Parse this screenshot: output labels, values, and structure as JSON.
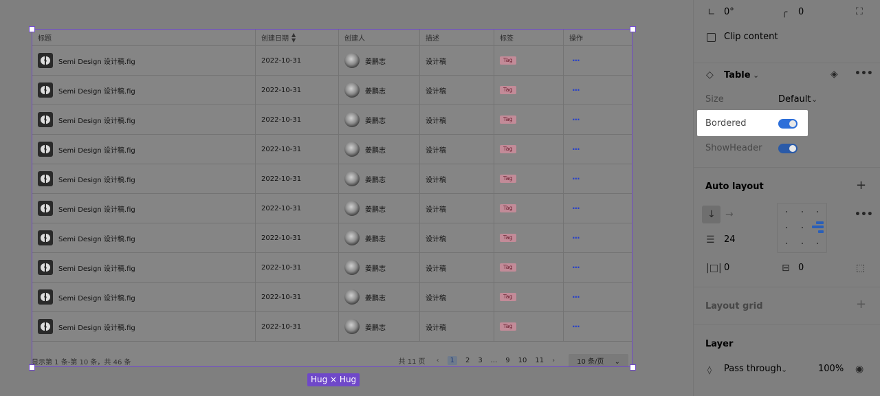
{
  "table": {
    "headers": [
      "标题",
      "创建日期",
      "创建人",
      "描述",
      "标签",
      "操作"
    ],
    "rows": [
      {
        "title": "Semi Design 设计稿.fig",
        "date": "2022-10-31",
        "creator": "姜鹏志",
        "desc": "设计稿",
        "tag": "Tag",
        "action": "···"
      },
      {
        "title": "Semi Design 设计稿.fig",
        "date": "2022-10-31",
        "creator": "姜鹏志",
        "desc": "设计稿",
        "tag": "Tag",
        "action": "···"
      },
      {
        "title": "Semi Design 设计稿.fig",
        "date": "2022-10-31",
        "creator": "姜鹏志",
        "desc": "设计稿",
        "tag": "Tag",
        "action": "···"
      },
      {
        "title": "Semi Design 设计稿.fig",
        "date": "2022-10-31",
        "creator": "姜鹏志",
        "desc": "设计稿",
        "tag": "Tag",
        "action": "···"
      },
      {
        "title": "Semi Design 设计稿.fig",
        "date": "2022-10-31",
        "creator": "姜鹏志",
        "desc": "设计稿",
        "tag": "Tag",
        "action": "···"
      },
      {
        "title": "Semi Design 设计稿.fig",
        "date": "2022-10-31",
        "creator": "姜鹏志",
        "desc": "设计稿",
        "tag": "Tag",
        "action": "···"
      },
      {
        "title": "Semi Design 设计稿.fig",
        "date": "2022-10-31",
        "creator": "姜鹏志",
        "desc": "设计稿",
        "tag": "Tag",
        "action": "···"
      },
      {
        "title": "Semi Design 设计稿.fig",
        "date": "2022-10-31",
        "creator": "姜鹏志",
        "desc": "设计稿",
        "tag": "Tag",
        "action": "···"
      },
      {
        "title": "Semi Design 设计稿.fig",
        "date": "2022-10-31",
        "creator": "姜鹏志",
        "desc": "设计稿",
        "tag": "Tag",
        "action": "···"
      },
      {
        "title": "Semi Design 设计稿.fig",
        "date": "2022-10-31",
        "creator": "姜鹏志",
        "desc": "设计稿",
        "tag": "Tag",
        "action": "···"
      }
    ],
    "footer_summary": "显示第 1 条-第 10 条，共 46 条",
    "pagination": {
      "total_pages": "共 11 页",
      "pages": [
        "1",
        "2",
        "3",
        "...",
        "9",
        "10",
        "11"
      ],
      "current": "1",
      "page_size": "10 条/页"
    }
  },
  "selection": {
    "size_label": "Hug × Hug"
  },
  "panel": {
    "rotation": "0°",
    "radius": "0",
    "clip_content": "Clip content",
    "component_name": "Table",
    "size_label": "Size",
    "size_value": "Default",
    "bordered_label": "Bordered",
    "bordered_on": true,
    "show_header_label": "ShowHeader",
    "show_header_on": true,
    "auto_layout_title": "Auto layout",
    "spacing": "24",
    "padding_h": "0",
    "padding_v": "0",
    "layout_grid_title": "Layout grid",
    "layer_title": "Layer",
    "blend_mode": "Pass through",
    "opacity": "100%"
  },
  "colors": {
    "selection": "#6f48c9",
    "toggle_on": "#2d6fd9",
    "link": "#2740c8"
  }
}
